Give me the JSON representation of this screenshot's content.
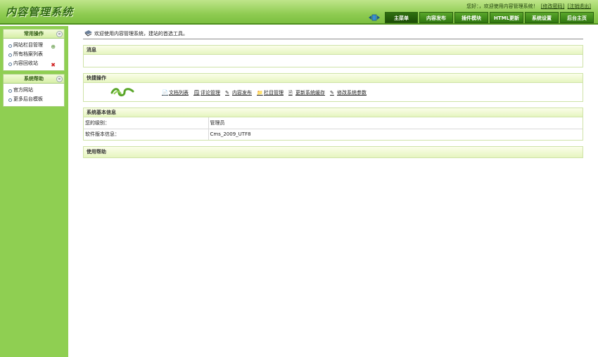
{
  "app": {
    "logo_text": "内容管理系统"
  },
  "header": {
    "greeting": "您好：，欢迎使用内容管理系统！",
    "change_password": "[修改密码]",
    "logout": "[注销退出]",
    "tabs": [
      "主菜单",
      "内容发布",
      "插件模块",
      "HTML更新",
      "系统设置",
      "后台主页"
    ],
    "active_tab": "主菜单"
  },
  "sidebar": {
    "groups": [
      {
        "title": "常用操作",
        "toggle": "«",
        "items": [
          "网站栏目管理",
          "所有档案列表",
          "内容回收站"
        ]
      },
      {
        "title": "系统帮助",
        "toggle": "«",
        "items": [
          "官方网站",
          "更多后台模板"
        ]
      }
    ]
  },
  "main": {
    "welcome": "欢迎使用内容管理系统，建站的首选工具。",
    "messages_title": "消息",
    "quick_title": "快捷操作",
    "quick_links": [
      {
        "label": "文档列表",
        "icon": "document-list-icon"
      },
      {
        "label": "评论管理",
        "icon": "comment-icon"
      },
      {
        "label": "内容发布",
        "icon": "pen-icon"
      },
      {
        "label": "栏目管理",
        "icon": "folder-icon"
      },
      {
        "label": "更新系统缓存",
        "icon": "refresh-icon"
      },
      {
        "label": "修改系统参数",
        "icon": "settings-pen-icon"
      }
    ],
    "sysinfo_title": "系统基本信息",
    "sysinfo_rows": [
      {
        "label": "您的级别：",
        "value": "管理员"
      },
      {
        "label": "软件版本信息：",
        "value": "Cms_2009_UTF8"
      }
    ],
    "help_title": "使用帮助"
  },
  "colors": {
    "header_green": "#8fcc52",
    "sidebar_green": "#8fcf52",
    "tab_dark": "#1c4d06",
    "panel_head": "#e6f5c0"
  }
}
